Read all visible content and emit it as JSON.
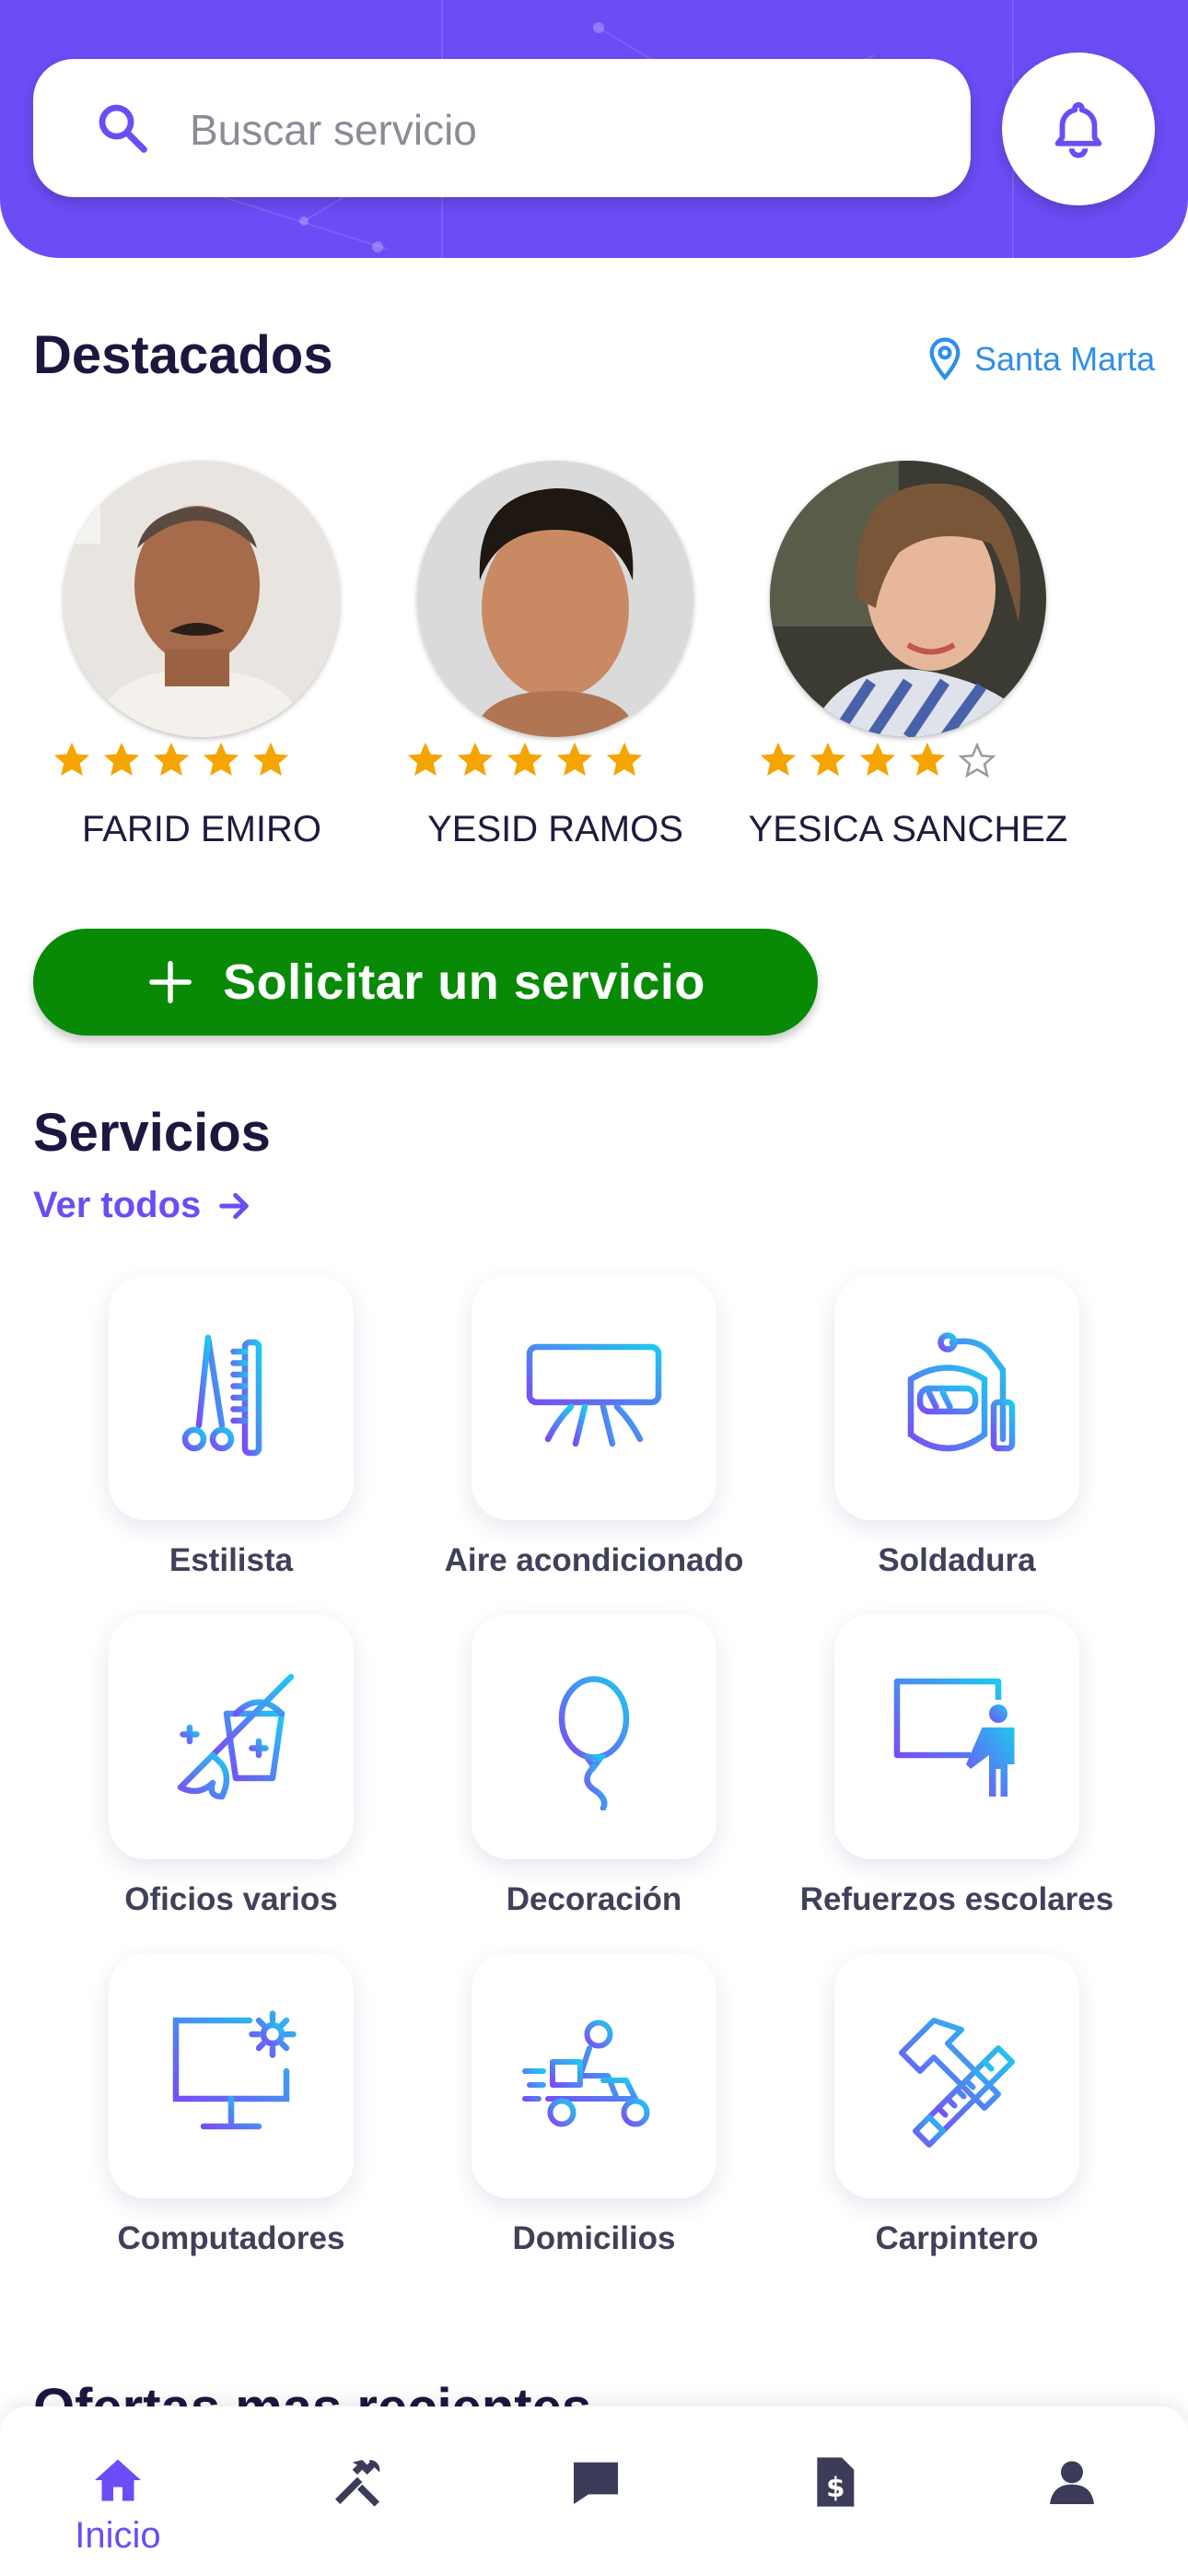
{
  "colors": {
    "primary": "#6c4cf5",
    "cta": "#088a06",
    "star": "#f5a400",
    "link": "#2f8fe8"
  },
  "search": {
    "placeholder": "Buscar servicio",
    "icon": "search-icon"
  },
  "notifications": {
    "icon": "bell-icon"
  },
  "featured": {
    "title": "Destacados",
    "location": "Santa Marta",
    "people": [
      {
        "name": "FARID EMIRO",
        "rating": 5
      },
      {
        "name": "YESID RAMOS",
        "rating": 5
      },
      {
        "name": "YESICA SANCHEZ",
        "rating": 4
      }
    ]
  },
  "cta": {
    "label": "Solicitar un servicio",
    "icon": "plus-icon"
  },
  "services": {
    "title": "Servicios",
    "see_all": "Ver todos",
    "items": [
      {
        "label": "Estilista",
        "icon": "scissors-comb-icon"
      },
      {
        "label": "Aire acondicionado",
        "icon": "air-conditioner-icon"
      },
      {
        "label": "Soldadura",
        "icon": "welding-mask-icon"
      },
      {
        "label": "Oficios varios",
        "icon": "cleaning-bucket-icon"
      },
      {
        "label": "Decoración",
        "icon": "balloon-icon"
      },
      {
        "label": "Refuerzos escolares",
        "icon": "teacher-board-icon"
      },
      {
        "label": "Computadores",
        "icon": "monitor-gear-icon"
      },
      {
        "label": "Domicilios",
        "icon": "delivery-scooter-icon"
      },
      {
        "label": "Carpintero",
        "icon": "hammer-saw-icon"
      }
    ]
  },
  "next_section": {
    "title": "Ofertas mas recientes"
  },
  "nav": {
    "items": [
      {
        "label": "Inicio",
        "icon": "home-icon",
        "active": true
      },
      {
        "label": "",
        "icon": "tools-icon"
      },
      {
        "label": "",
        "icon": "chat-icon"
      },
      {
        "label": "",
        "icon": "invoice-icon"
      },
      {
        "label": "",
        "icon": "user-icon"
      }
    ]
  }
}
